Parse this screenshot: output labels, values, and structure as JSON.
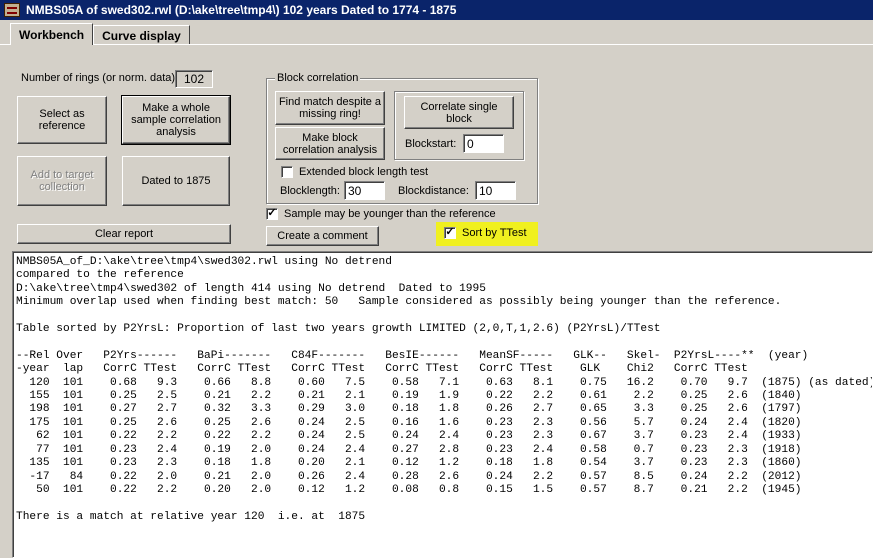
{
  "window": {
    "title": "NMBS05A of swed302.rwl    (D:\\ake\\tree\\tmp4\\)  102 years  Dated to 1774 - 1875",
    "icon": "app-icon"
  },
  "tabs": [
    {
      "label": "Workbench",
      "active": true
    },
    {
      "label": "Curve display",
      "active": false
    }
  ],
  "rings": {
    "label": "Number of rings (or norm. data):",
    "value": "102"
  },
  "buttons": {
    "select_reference": "Select as reference",
    "whole_sample": "Make a whole sample correlation analysis",
    "add_target": "Add to target collection",
    "dated": "Dated to 1875",
    "clear_report": "Clear report",
    "create_comment": "Create a comment"
  },
  "block": {
    "group_label": "Block correlation",
    "find_match": "Find match despite a missing ring!",
    "make_block": "Make block correlation analysis",
    "correlate_single": "Correlate single block",
    "blockstart_label": "Blockstart:",
    "blockstart_value": "0",
    "extended_label": "Extended block length test",
    "extended_checked": false,
    "blocklength_label": "Blocklength:",
    "blocklength_value": "30",
    "blockdistance_label": "Blockdistance:",
    "blockdistance_value": "10"
  },
  "options": {
    "younger_label": "Sample may be younger than the reference",
    "younger_checked": true,
    "sort_label": "Sort by TTest",
    "sort_checked": true,
    "highlight_color": "#f0f020"
  },
  "report": {
    "lines": [
      "NMBS05A_of_D:\\ake\\tree\\tmp4\\swed302.rwl using No detrend",
      "compared to the reference",
      "D:\\ake\\tree\\tmp4\\swed302 of length 414 using No detrend  Dated to 1995",
      "Minimum overlap used when finding best match: 50   Sample considered as possibly being younger than the reference.",
      "",
      "Table sorted by P2YrsL: Proportion of last two years growth LIMITED (2,0,T,1,2.6) (P2YrsL)/TTest",
      "",
      "--Rel Over   P2Yrs------   BaPi-------   C84F-------   BesIE------   MeanSF-----   GLK--   Skel-  P2YrsL----**  (year)",
      "-year  lap   CorrC TTest   CorrC TTest   CorrC TTest   CorrC TTest   CorrC TTest    GLK    Chi2   CorrC TTest",
      "  120  101    0.68   9.3    0.66   8.8    0.60   7.5    0.58   7.1    0.63   8.1    0.75   16.2    0.70   9.7  (1875) (as dated)",
      "  155  101    0.25   2.5    0.21   2.2    0.21   2.1    0.19   1.9    0.22   2.2    0.61    2.2    0.25   2.6  (1840)",
      "  198  101    0.27   2.7    0.32   3.3    0.29   3.0    0.18   1.8    0.26   2.7    0.65    3.3    0.25   2.6  (1797)",
      "  175  101    0.25   2.6    0.25   2.6    0.24   2.5    0.16   1.6    0.23   2.3    0.56    5.7    0.24   2.4  (1820)",
      "   62  101    0.22   2.2    0.22   2.2    0.24   2.5    0.24   2.4    0.23   2.3    0.67    3.7    0.23   2.4  (1933)",
      "   77  101    0.23   2.4    0.19   2.0    0.24   2.4    0.27   2.8    0.23   2.4    0.58    0.7    0.23   2.3  (1918)",
      "  135  101    0.23   2.3    0.18   1.8    0.20   2.1    0.12   1.2    0.18   1.8    0.54    3.7    0.23   2.3  (1860)",
      "  -17   84    0.22   2.0    0.21   2.0    0.26   2.4    0.28   2.6    0.24   2.2    0.57    8.5    0.24   2.2  (2012)",
      "   50  101    0.22   2.2    0.20   2.0    0.12   1.2    0.08   0.8    0.15   1.5    0.57    8.7    0.21   2.2  (1945)",
      "",
      "There is a match at relative year 120  i.e. at  1875"
    ]
  }
}
